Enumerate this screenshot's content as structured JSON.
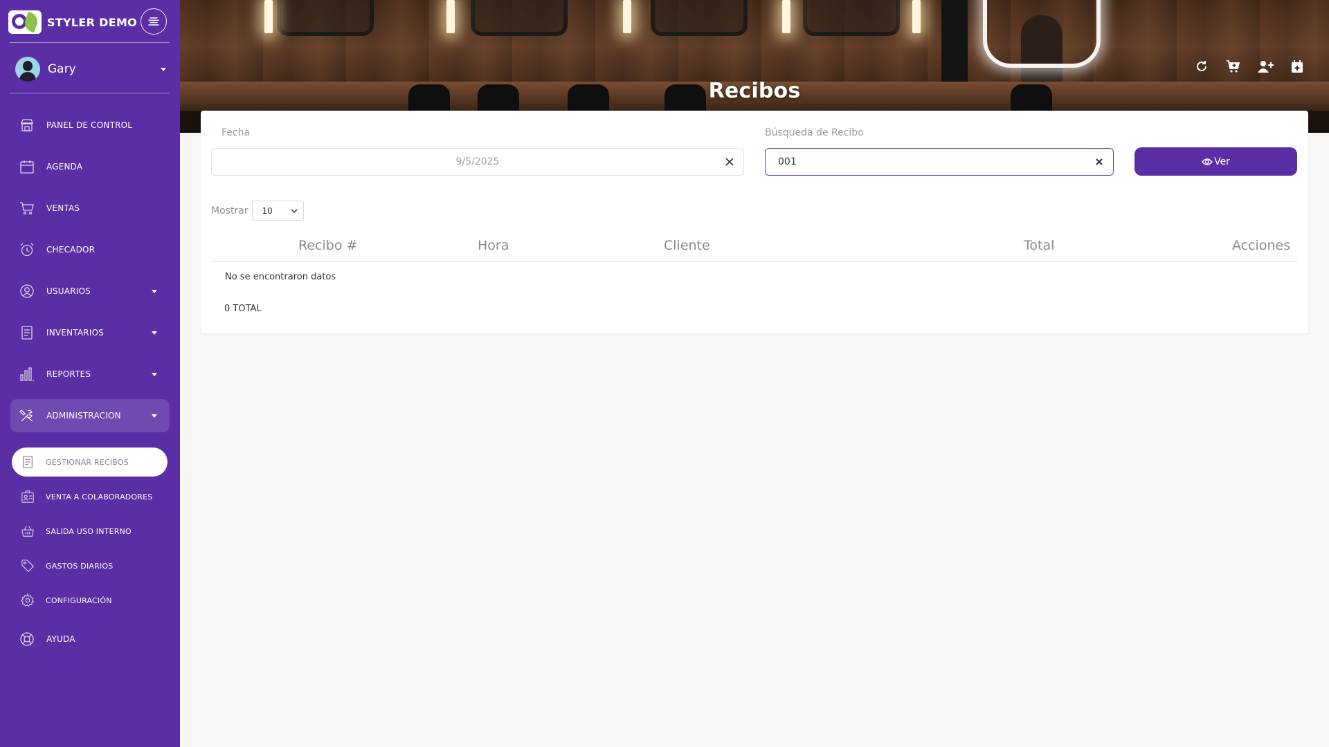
{
  "brand": {
    "name": "STYLER DEMO"
  },
  "user": {
    "name": "Gary"
  },
  "nav": {
    "items": [
      {
        "label": "PANEL DE CONTROL",
        "icon": "store-icon"
      },
      {
        "label": "AGENDA",
        "icon": "calendar-icon"
      },
      {
        "label": "VENTAS",
        "icon": "cart-icon"
      },
      {
        "label": "CHECADOR",
        "icon": "alarm-clock-icon"
      },
      {
        "label": "USUARIOS",
        "icon": "user-circle-icon"
      },
      {
        "label": "INVENTARIOS",
        "icon": "document-list-icon"
      },
      {
        "label": "REPORTES",
        "icon": "bar-chart-icon"
      },
      {
        "label": "ADMINISTRACION",
        "icon": "tools-icon"
      }
    ],
    "sub_items": [
      {
        "label": "GESTIONAR RECIBOS",
        "icon": "receipt-icon"
      },
      {
        "label": "VENTA A COLABORADORES",
        "icon": "id-badge-icon"
      },
      {
        "label": "SALIDA USO INTERNO",
        "icon": "basket-icon"
      },
      {
        "label": "GASTOS DIARIOS",
        "icon": "tag-icon"
      },
      {
        "label": "CONFIGURACIÓN",
        "icon": "settings-icon"
      }
    ],
    "help": {
      "label": "AYUDA",
      "icon": "lifebuoy-icon"
    }
  },
  "header": {
    "title": "Recibos",
    "icons": [
      "refresh-icon",
      "cart-add-icon",
      "add-user-icon",
      "calendar-add-icon"
    ]
  },
  "filters": {
    "date_label": "Fecha",
    "date_value": "9/5/2025",
    "search_label": "Búsqueda de Recibo",
    "search_value": "001",
    "view_button": "Ver"
  },
  "table": {
    "show_label": "Mostrar",
    "page_size": "10",
    "columns": [
      "Recibo #",
      "Hora",
      "Cliente",
      "Total",
      "Acciones"
    ],
    "empty_message": "No se encontraron datos",
    "total_text": "0 TOTAL"
  },
  "colors": {
    "primary": "#5b2ea6",
    "sidebar": "#5b2ea6",
    "background": "#f7f7f7"
  }
}
